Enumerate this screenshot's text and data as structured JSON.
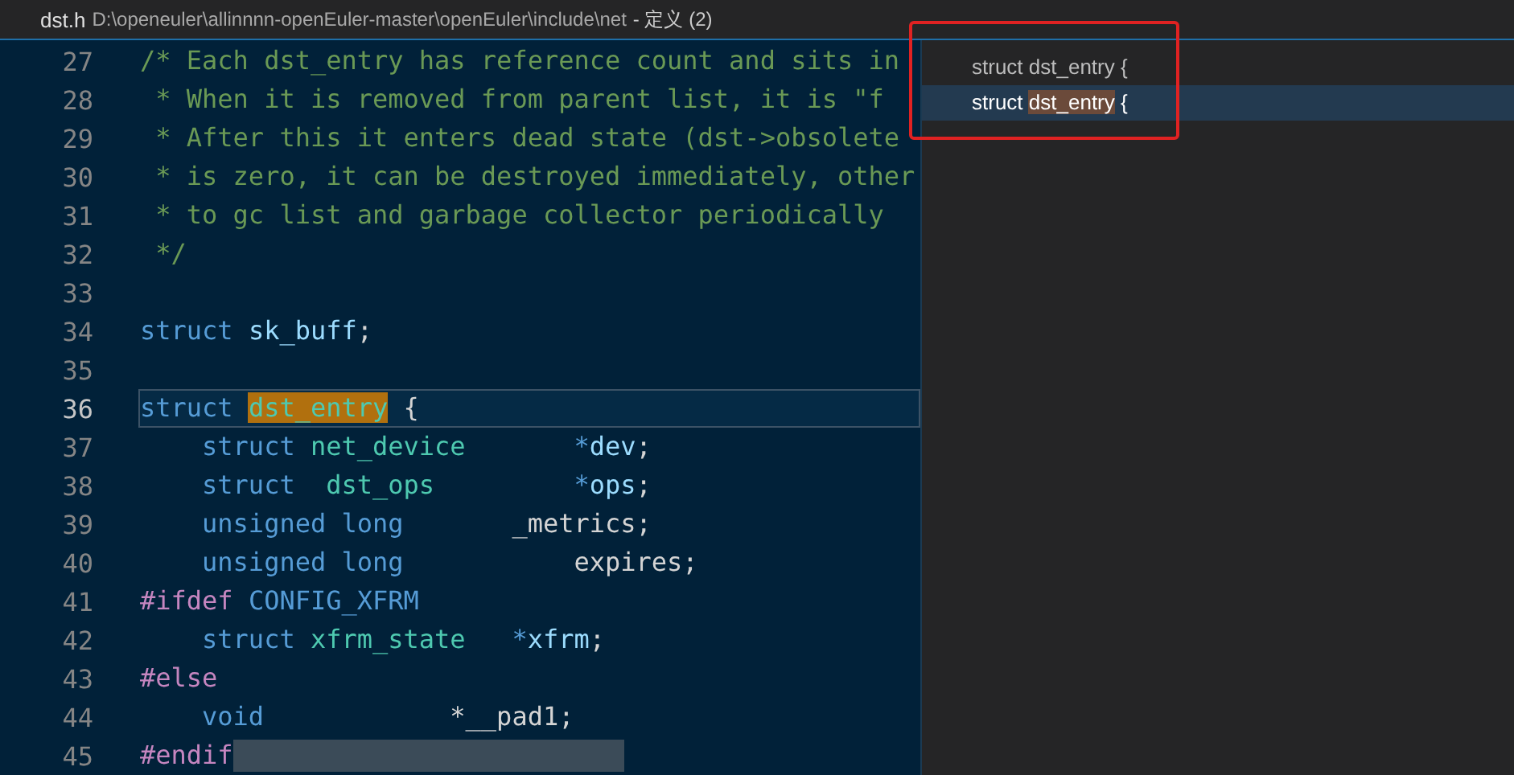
{
  "header": {
    "filename": "dst.h",
    "path": "D:\\openeuler\\allinnnn-openEuler-master\\openEuler\\include\\net",
    "suffix": "- 定义 (2)"
  },
  "code_lines": [
    {
      "number": "27",
      "current": false,
      "tokens": [
        {
          "text": "/* Each dst_entry has reference count and sits in",
          "kind": "comment"
        }
      ]
    },
    {
      "number": "28",
      "current": false,
      "tokens": [
        {
          "text": " * When it is removed from parent list, it is \"f",
          "kind": "comment"
        }
      ]
    },
    {
      "number": "29",
      "current": false,
      "tokens": [
        {
          "text": " * After this it enters dead state (dst->obsolete",
          "kind": "comment"
        }
      ]
    },
    {
      "number": "30",
      "current": false,
      "tokens": [
        {
          "text": " * is zero, it can be destroyed immediately, other",
          "kind": "comment"
        }
      ]
    },
    {
      "number": "31",
      "current": false,
      "tokens": [
        {
          "text": " * to gc list and garbage collector periodically",
          "kind": "comment"
        }
      ]
    },
    {
      "number": "32",
      "current": false,
      "tokens": [
        {
          "text": " */",
          "kind": "comment"
        }
      ]
    },
    {
      "number": "33",
      "current": false
    },
    {
      "number": "34",
      "current": false,
      "tokens": [
        {
          "text": "struct ",
          "kind": "keyword"
        },
        {
          "text": "sk_buff",
          "kind": "var"
        },
        {
          "text": ";",
          "kind": "plain"
        }
      ]
    },
    {
      "number": "35",
      "current": false
    },
    {
      "number": "36",
      "current": true,
      "tokens": [
        {
          "text": "struct ",
          "kind": "keyword"
        },
        {
          "text": "dst_entry",
          "kind": "match"
        },
        {
          "text": " {",
          "kind": "plain"
        }
      ]
    },
    {
      "number": "37",
      "current": false,
      "tokens": [
        {
          "text": "    struct ",
          "kind": "keyword"
        },
        {
          "text": "net_device",
          "kind": "type"
        },
        {
          "text": "       *",
          "kind": "keyword"
        },
        {
          "text": "dev",
          "kind": "var"
        },
        {
          "text": ";",
          "kind": "plain"
        }
      ]
    },
    {
      "number": "38",
      "current": false,
      "tokens": [
        {
          "text": "    struct  ",
          "kind": "keyword"
        },
        {
          "text": "dst_ops",
          "kind": "type"
        },
        {
          "text": "         *",
          "kind": "keyword"
        },
        {
          "text": "ops",
          "kind": "var"
        },
        {
          "text": ";",
          "kind": "plain"
        }
      ]
    },
    {
      "number": "39",
      "current": false,
      "tokens": [
        {
          "text": "    unsigned long",
          "kind": "keyword"
        },
        {
          "text": "       _metrics;",
          "kind": "plain"
        }
      ]
    },
    {
      "number": "40",
      "current": false,
      "tokens": [
        {
          "text": "    unsigned long",
          "kind": "keyword"
        },
        {
          "text": "           expires;",
          "kind": "plain"
        }
      ]
    },
    {
      "number": "41",
      "current": false,
      "tokens": [
        {
          "text": "#ifdef ",
          "kind": "macro"
        },
        {
          "text": "CONFIG_XFRM",
          "kind": "keyword"
        }
      ]
    },
    {
      "number": "42",
      "current": false,
      "tokens": [
        {
          "text": "    struct ",
          "kind": "keyword"
        },
        {
          "text": "xfrm_state",
          "kind": "type"
        },
        {
          "text": "   *",
          "kind": "keyword"
        },
        {
          "text": "xfrm",
          "kind": "var"
        },
        {
          "text": ";",
          "kind": "plain"
        }
      ]
    },
    {
      "number": "43",
      "current": false,
      "tokens": [
        {
          "text": "#else",
          "kind": "macro"
        }
      ]
    },
    {
      "number": "44",
      "current": false,
      "tokens": [
        {
          "text": "    void",
          "kind": "keyword"
        },
        {
          "text": "            *__pad1;",
          "kind": "plain"
        }
      ]
    },
    {
      "number": "45",
      "current": false,
      "selection_after": true,
      "tokens": [
        {
          "text": "#endif",
          "kind": "macro"
        }
      ]
    }
  ],
  "references": [
    {
      "selected": false,
      "tokens": [
        {
          "text": "struct dst_entry {",
          "kind": "plain"
        }
      ]
    },
    {
      "selected": true,
      "tokens": [
        {
          "text": "struct ",
          "kind": "plain"
        },
        {
          "text": "dst_entry",
          "kind": "match"
        },
        {
          "text": " {",
          "kind": "plain"
        }
      ]
    }
  ],
  "highlight_box": true
}
